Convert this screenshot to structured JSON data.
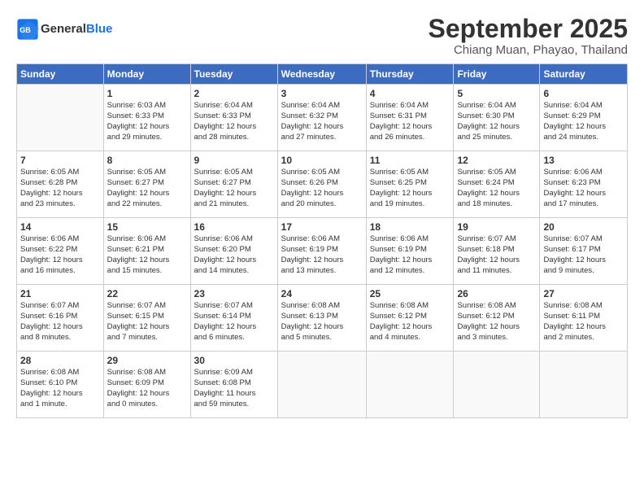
{
  "header": {
    "logo_line1": "General",
    "logo_line2": "Blue",
    "main_title": "September 2025",
    "subtitle": "Chiang Muan, Phayao, Thailand"
  },
  "weekdays": [
    "Sunday",
    "Monday",
    "Tuesday",
    "Wednesday",
    "Thursday",
    "Friday",
    "Saturday"
  ],
  "weeks": [
    [
      {
        "day": "",
        "text": ""
      },
      {
        "day": "1",
        "text": "Sunrise: 6:03 AM\nSunset: 6:33 PM\nDaylight: 12 hours\nand 29 minutes."
      },
      {
        "day": "2",
        "text": "Sunrise: 6:04 AM\nSunset: 6:33 PM\nDaylight: 12 hours\nand 28 minutes."
      },
      {
        "day": "3",
        "text": "Sunrise: 6:04 AM\nSunset: 6:32 PM\nDaylight: 12 hours\nand 27 minutes."
      },
      {
        "day": "4",
        "text": "Sunrise: 6:04 AM\nSunset: 6:31 PM\nDaylight: 12 hours\nand 26 minutes."
      },
      {
        "day": "5",
        "text": "Sunrise: 6:04 AM\nSunset: 6:30 PM\nDaylight: 12 hours\nand 25 minutes."
      },
      {
        "day": "6",
        "text": "Sunrise: 6:04 AM\nSunset: 6:29 PM\nDaylight: 12 hours\nand 24 minutes."
      }
    ],
    [
      {
        "day": "7",
        "text": "Sunrise: 6:05 AM\nSunset: 6:28 PM\nDaylight: 12 hours\nand 23 minutes."
      },
      {
        "day": "8",
        "text": "Sunrise: 6:05 AM\nSunset: 6:27 PM\nDaylight: 12 hours\nand 22 minutes."
      },
      {
        "day": "9",
        "text": "Sunrise: 6:05 AM\nSunset: 6:27 PM\nDaylight: 12 hours\nand 21 minutes."
      },
      {
        "day": "10",
        "text": "Sunrise: 6:05 AM\nSunset: 6:26 PM\nDaylight: 12 hours\nand 20 minutes."
      },
      {
        "day": "11",
        "text": "Sunrise: 6:05 AM\nSunset: 6:25 PM\nDaylight: 12 hours\nand 19 minutes."
      },
      {
        "day": "12",
        "text": "Sunrise: 6:05 AM\nSunset: 6:24 PM\nDaylight: 12 hours\nand 18 minutes."
      },
      {
        "day": "13",
        "text": "Sunrise: 6:06 AM\nSunset: 6:23 PM\nDaylight: 12 hours\nand 17 minutes."
      }
    ],
    [
      {
        "day": "14",
        "text": "Sunrise: 6:06 AM\nSunset: 6:22 PM\nDaylight: 12 hours\nand 16 minutes."
      },
      {
        "day": "15",
        "text": "Sunrise: 6:06 AM\nSunset: 6:21 PM\nDaylight: 12 hours\nand 15 minutes."
      },
      {
        "day": "16",
        "text": "Sunrise: 6:06 AM\nSunset: 6:20 PM\nDaylight: 12 hours\nand 14 minutes."
      },
      {
        "day": "17",
        "text": "Sunrise: 6:06 AM\nSunset: 6:19 PM\nDaylight: 12 hours\nand 13 minutes."
      },
      {
        "day": "18",
        "text": "Sunrise: 6:06 AM\nSunset: 6:19 PM\nDaylight: 12 hours\nand 12 minutes."
      },
      {
        "day": "19",
        "text": "Sunrise: 6:07 AM\nSunset: 6:18 PM\nDaylight: 12 hours\nand 11 minutes."
      },
      {
        "day": "20",
        "text": "Sunrise: 6:07 AM\nSunset: 6:17 PM\nDaylight: 12 hours\nand 9 minutes."
      }
    ],
    [
      {
        "day": "21",
        "text": "Sunrise: 6:07 AM\nSunset: 6:16 PM\nDaylight: 12 hours\nand 8 minutes."
      },
      {
        "day": "22",
        "text": "Sunrise: 6:07 AM\nSunset: 6:15 PM\nDaylight: 12 hours\nand 7 minutes."
      },
      {
        "day": "23",
        "text": "Sunrise: 6:07 AM\nSunset: 6:14 PM\nDaylight: 12 hours\nand 6 minutes."
      },
      {
        "day": "24",
        "text": "Sunrise: 6:08 AM\nSunset: 6:13 PM\nDaylight: 12 hours\nand 5 minutes."
      },
      {
        "day": "25",
        "text": "Sunrise: 6:08 AM\nSunset: 6:12 PM\nDaylight: 12 hours\nand 4 minutes."
      },
      {
        "day": "26",
        "text": "Sunrise: 6:08 AM\nSunset: 6:12 PM\nDaylight: 12 hours\nand 3 minutes."
      },
      {
        "day": "27",
        "text": "Sunrise: 6:08 AM\nSunset: 6:11 PM\nDaylight: 12 hours\nand 2 minutes."
      }
    ],
    [
      {
        "day": "28",
        "text": "Sunrise: 6:08 AM\nSunset: 6:10 PM\nDaylight: 12 hours\nand 1 minute."
      },
      {
        "day": "29",
        "text": "Sunrise: 6:08 AM\nSunset: 6:09 PM\nDaylight: 12 hours\nand 0 minutes."
      },
      {
        "day": "30",
        "text": "Sunrise: 6:09 AM\nSunset: 6:08 PM\nDaylight: 11 hours\nand 59 minutes."
      },
      {
        "day": "",
        "text": ""
      },
      {
        "day": "",
        "text": ""
      },
      {
        "day": "",
        "text": ""
      },
      {
        "day": "",
        "text": ""
      }
    ]
  ]
}
